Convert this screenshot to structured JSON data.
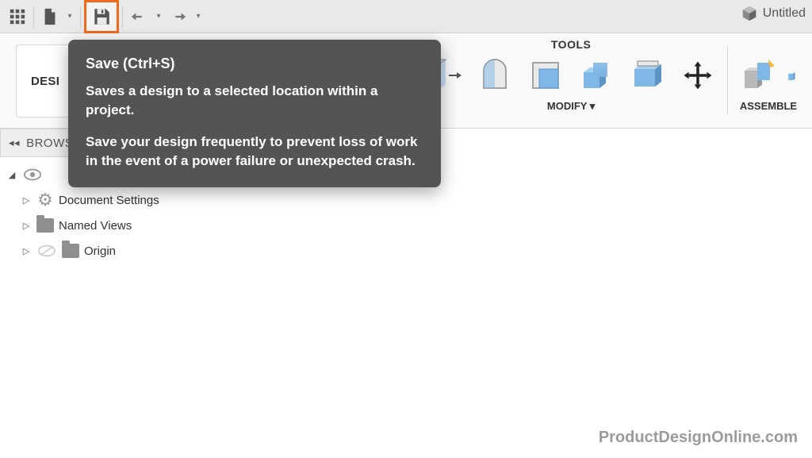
{
  "qat": {
    "doc_title": "Untitled"
  },
  "ribbon": {
    "design_label": "DESI",
    "tools_label": "TOOLS",
    "modify_label": "MODIFY ▾",
    "assemble_label": "ASSEMBLE"
  },
  "browser": {
    "header": "BROWS",
    "items": [
      {
        "label": "Document Settings"
      },
      {
        "label": "Named Views"
      },
      {
        "label": "Origin"
      }
    ]
  },
  "tooltip": {
    "title": "Save (Ctrl+S)",
    "line1": "Saves a design to a selected location within a project.",
    "line2": "Save your design frequently to prevent loss of work in the event of a power failure or unexpected crash."
  },
  "watermark": "ProductDesignOnline.com"
}
